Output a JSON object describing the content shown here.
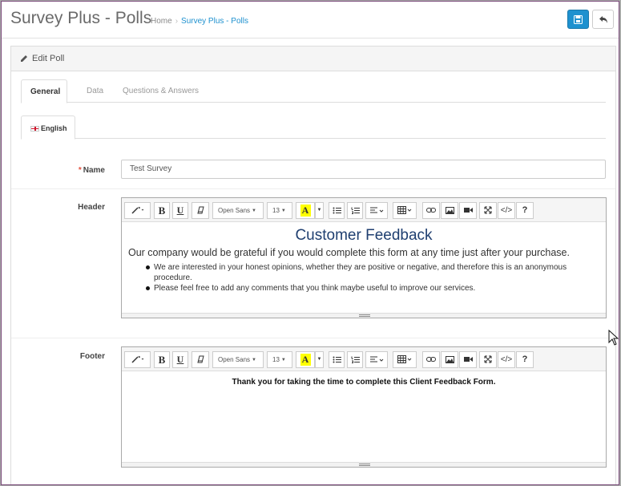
{
  "header": {
    "title": "Survey Plus - Polls",
    "breadcrumb": {
      "home": "Home",
      "separator": "›",
      "current": "Survey Plus - Polls"
    },
    "save_icon": "save-icon",
    "back_icon": "reply-icon"
  },
  "panel": {
    "heading": "Edit Poll",
    "heading_icon": "pencil-icon"
  },
  "tabs": [
    "General",
    "Data",
    "Questions & Answers"
  ],
  "language_tab": {
    "label": "English",
    "icon": "flag-uk-icon"
  },
  "form": {
    "name": {
      "label": "Name",
      "required": "*",
      "value": "Test Survey"
    },
    "header": {
      "label": "Header",
      "title": "Customer Feedback",
      "paragraph": "Our company would be grateful if you would complete this form at any time just after your purchase.",
      "bullets": [
        "We are interested in your honest opinions, whether they are positive or negative, and therefore this is an anonymous procedure.",
        "Please feel free to add any comments that you think maybe useful to improve our services."
      ]
    },
    "footer": {
      "label": "Footer",
      "text": "Thank you for taking the time to complete this Client Feedback Form."
    }
  },
  "toolbar": {
    "font_family": "Open Sans",
    "font_size": "13",
    "highlight_letter": "A",
    "bold": "B",
    "underline": "U",
    "help": "?"
  },
  "colors": {
    "accent": "#1e91cf",
    "title_blue": "#1f3f70",
    "required": "#e3503e",
    "highlight": "#ffff00"
  }
}
